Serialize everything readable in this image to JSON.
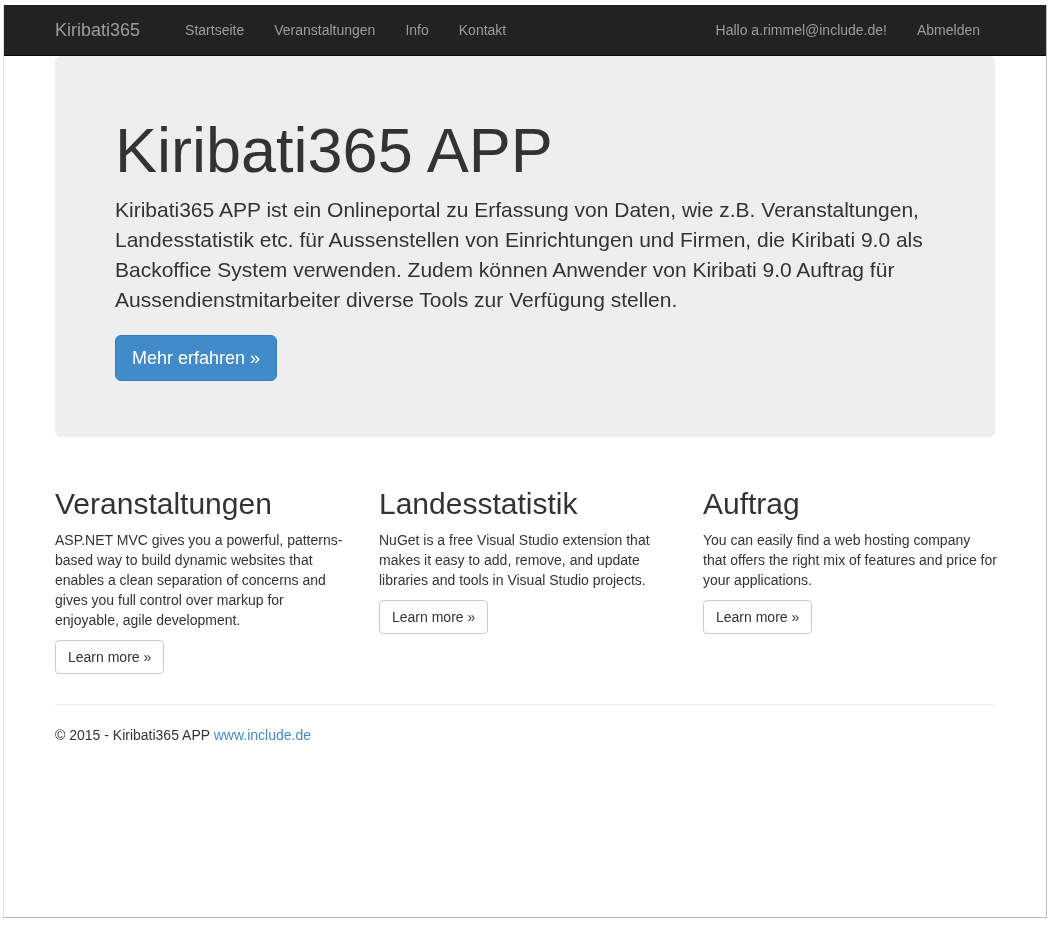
{
  "navbar": {
    "brand": "Kiribati365",
    "links": [
      {
        "label": "Startseite"
      },
      {
        "label": "Veranstaltungen"
      },
      {
        "label": "Info"
      },
      {
        "label": "Kontakt"
      }
    ],
    "greeting": "Hallo a.rimmel@include.de!",
    "logout": "Abmelden"
  },
  "jumbotron": {
    "title": "Kiribati365 APP",
    "lead": "Kiribati365 APP ist ein Onlineportal zu Erfassung von Daten, wie z.B. Veranstaltungen, Landesstatistik etc. für Aussenstellen von Einrichtungen und Firmen, die Kiribati 9.0 als Backoffice System verwenden. Zudem können Anwender von Kiribati 9.0 Auftrag für Aussendienstmitarbeiter diverse Tools zur Verfügung stellen.",
    "button": "Mehr erfahren »"
  },
  "columns": [
    {
      "heading": "Veranstaltungen",
      "text": "ASP.NET MVC gives you a powerful, patterns-based way to build dynamic websites that enables a clean separation of concerns and gives you full control over markup for enjoyable, agile development.",
      "button": "Learn more »"
    },
    {
      "heading": "Landesstatistik",
      "text": "NuGet is a free Visual Studio extension that makes it easy to add, remove, and update libraries and tools in Visual Studio projects.",
      "button": "Learn more »"
    },
    {
      "heading": "Auftrag",
      "text": "You can easily find a web hosting company that offers the right mix of features and price for your applications.",
      "button": "Learn more »"
    }
  ],
  "footer": {
    "text": "© 2015 - Kiribati365 APP",
    "link": "www.include.de"
  }
}
